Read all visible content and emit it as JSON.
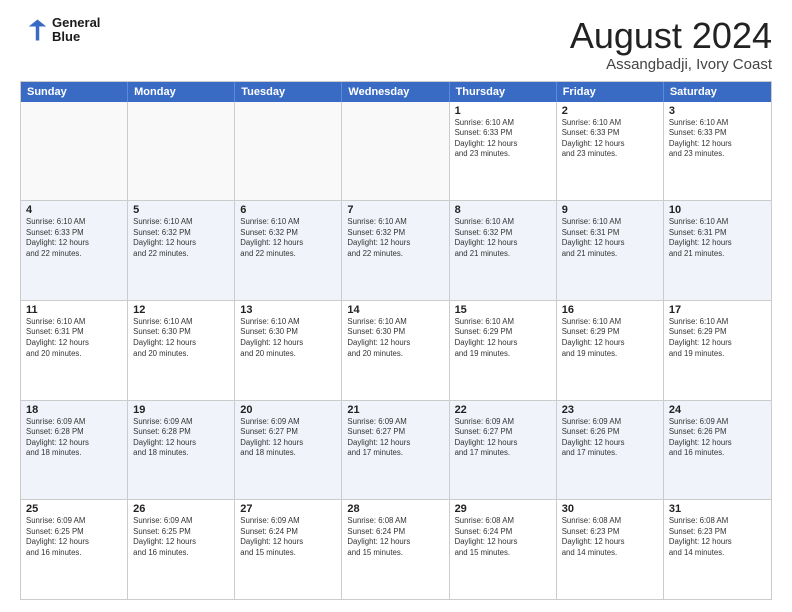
{
  "header": {
    "logo_line1": "General",
    "logo_line2": "Blue",
    "month": "August 2024",
    "location": "Assangbadji, Ivory Coast"
  },
  "weekdays": [
    "Sunday",
    "Monday",
    "Tuesday",
    "Wednesday",
    "Thursday",
    "Friday",
    "Saturday"
  ],
  "rows": [
    [
      {
        "day": "",
        "info": ""
      },
      {
        "day": "",
        "info": ""
      },
      {
        "day": "",
        "info": ""
      },
      {
        "day": "",
        "info": ""
      },
      {
        "day": "1",
        "info": "Sunrise: 6:10 AM\nSunset: 6:33 PM\nDaylight: 12 hours\nand 23 minutes."
      },
      {
        "day": "2",
        "info": "Sunrise: 6:10 AM\nSunset: 6:33 PM\nDaylight: 12 hours\nand 23 minutes."
      },
      {
        "day": "3",
        "info": "Sunrise: 6:10 AM\nSunset: 6:33 PM\nDaylight: 12 hours\nand 23 minutes."
      }
    ],
    [
      {
        "day": "4",
        "info": "Sunrise: 6:10 AM\nSunset: 6:33 PM\nDaylight: 12 hours\nand 22 minutes."
      },
      {
        "day": "5",
        "info": "Sunrise: 6:10 AM\nSunset: 6:32 PM\nDaylight: 12 hours\nand 22 minutes."
      },
      {
        "day": "6",
        "info": "Sunrise: 6:10 AM\nSunset: 6:32 PM\nDaylight: 12 hours\nand 22 minutes."
      },
      {
        "day": "7",
        "info": "Sunrise: 6:10 AM\nSunset: 6:32 PM\nDaylight: 12 hours\nand 22 minutes."
      },
      {
        "day": "8",
        "info": "Sunrise: 6:10 AM\nSunset: 6:32 PM\nDaylight: 12 hours\nand 21 minutes."
      },
      {
        "day": "9",
        "info": "Sunrise: 6:10 AM\nSunset: 6:31 PM\nDaylight: 12 hours\nand 21 minutes."
      },
      {
        "day": "10",
        "info": "Sunrise: 6:10 AM\nSunset: 6:31 PM\nDaylight: 12 hours\nand 21 minutes."
      }
    ],
    [
      {
        "day": "11",
        "info": "Sunrise: 6:10 AM\nSunset: 6:31 PM\nDaylight: 12 hours\nand 20 minutes."
      },
      {
        "day": "12",
        "info": "Sunrise: 6:10 AM\nSunset: 6:30 PM\nDaylight: 12 hours\nand 20 minutes."
      },
      {
        "day": "13",
        "info": "Sunrise: 6:10 AM\nSunset: 6:30 PM\nDaylight: 12 hours\nand 20 minutes."
      },
      {
        "day": "14",
        "info": "Sunrise: 6:10 AM\nSunset: 6:30 PM\nDaylight: 12 hours\nand 20 minutes."
      },
      {
        "day": "15",
        "info": "Sunrise: 6:10 AM\nSunset: 6:29 PM\nDaylight: 12 hours\nand 19 minutes."
      },
      {
        "day": "16",
        "info": "Sunrise: 6:10 AM\nSunset: 6:29 PM\nDaylight: 12 hours\nand 19 minutes."
      },
      {
        "day": "17",
        "info": "Sunrise: 6:10 AM\nSunset: 6:29 PM\nDaylight: 12 hours\nand 19 minutes."
      }
    ],
    [
      {
        "day": "18",
        "info": "Sunrise: 6:09 AM\nSunset: 6:28 PM\nDaylight: 12 hours\nand 18 minutes."
      },
      {
        "day": "19",
        "info": "Sunrise: 6:09 AM\nSunset: 6:28 PM\nDaylight: 12 hours\nand 18 minutes."
      },
      {
        "day": "20",
        "info": "Sunrise: 6:09 AM\nSunset: 6:27 PM\nDaylight: 12 hours\nand 18 minutes."
      },
      {
        "day": "21",
        "info": "Sunrise: 6:09 AM\nSunset: 6:27 PM\nDaylight: 12 hours\nand 17 minutes."
      },
      {
        "day": "22",
        "info": "Sunrise: 6:09 AM\nSunset: 6:27 PM\nDaylight: 12 hours\nand 17 minutes."
      },
      {
        "day": "23",
        "info": "Sunrise: 6:09 AM\nSunset: 6:26 PM\nDaylight: 12 hours\nand 17 minutes."
      },
      {
        "day": "24",
        "info": "Sunrise: 6:09 AM\nSunset: 6:26 PM\nDaylight: 12 hours\nand 16 minutes."
      }
    ],
    [
      {
        "day": "25",
        "info": "Sunrise: 6:09 AM\nSunset: 6:25 PM\nDaylight: 12 hours\nand 16 minutes."
      },
      {
        "day": "26",
        "info": "Sunrise: 6:09 AM\nSunset: 6:25 PM\nDaylight: 12 hours\nand 16 minutes."
      },
      {
        "day": "27",
        "info": "Sunrise: 6:09 AM\nSunset: 6:24 PM\nDaylight: 12 hours\nand 15 minutes."
      },
      {
        "day": "28",
        "info": "Sunrise: 6:08 AM\nSunset: 6:24 PM\nDaylight: 12 hours\nand 15 minutes."
      },
      {
        "day": "29",
        "info": "Sunrise: 6:08 AM\nSunset: 6:24 PM\nDaylight: 12 hours\nand 15 minutes."
      },
      {
        "day": "30",
        "info": "Sunrise: 6:08 AM\nSunset: 6:23 PM\nDaylight: 12 hours\nand 14 minutes."
      },
      {
        "day": "31",
        "info": "Sunrise: 6:08 AM\nSunset: 6:23 PM\nDaylight: 12 hours\nand 14 minutes."
      }
    ]
  ]
}
